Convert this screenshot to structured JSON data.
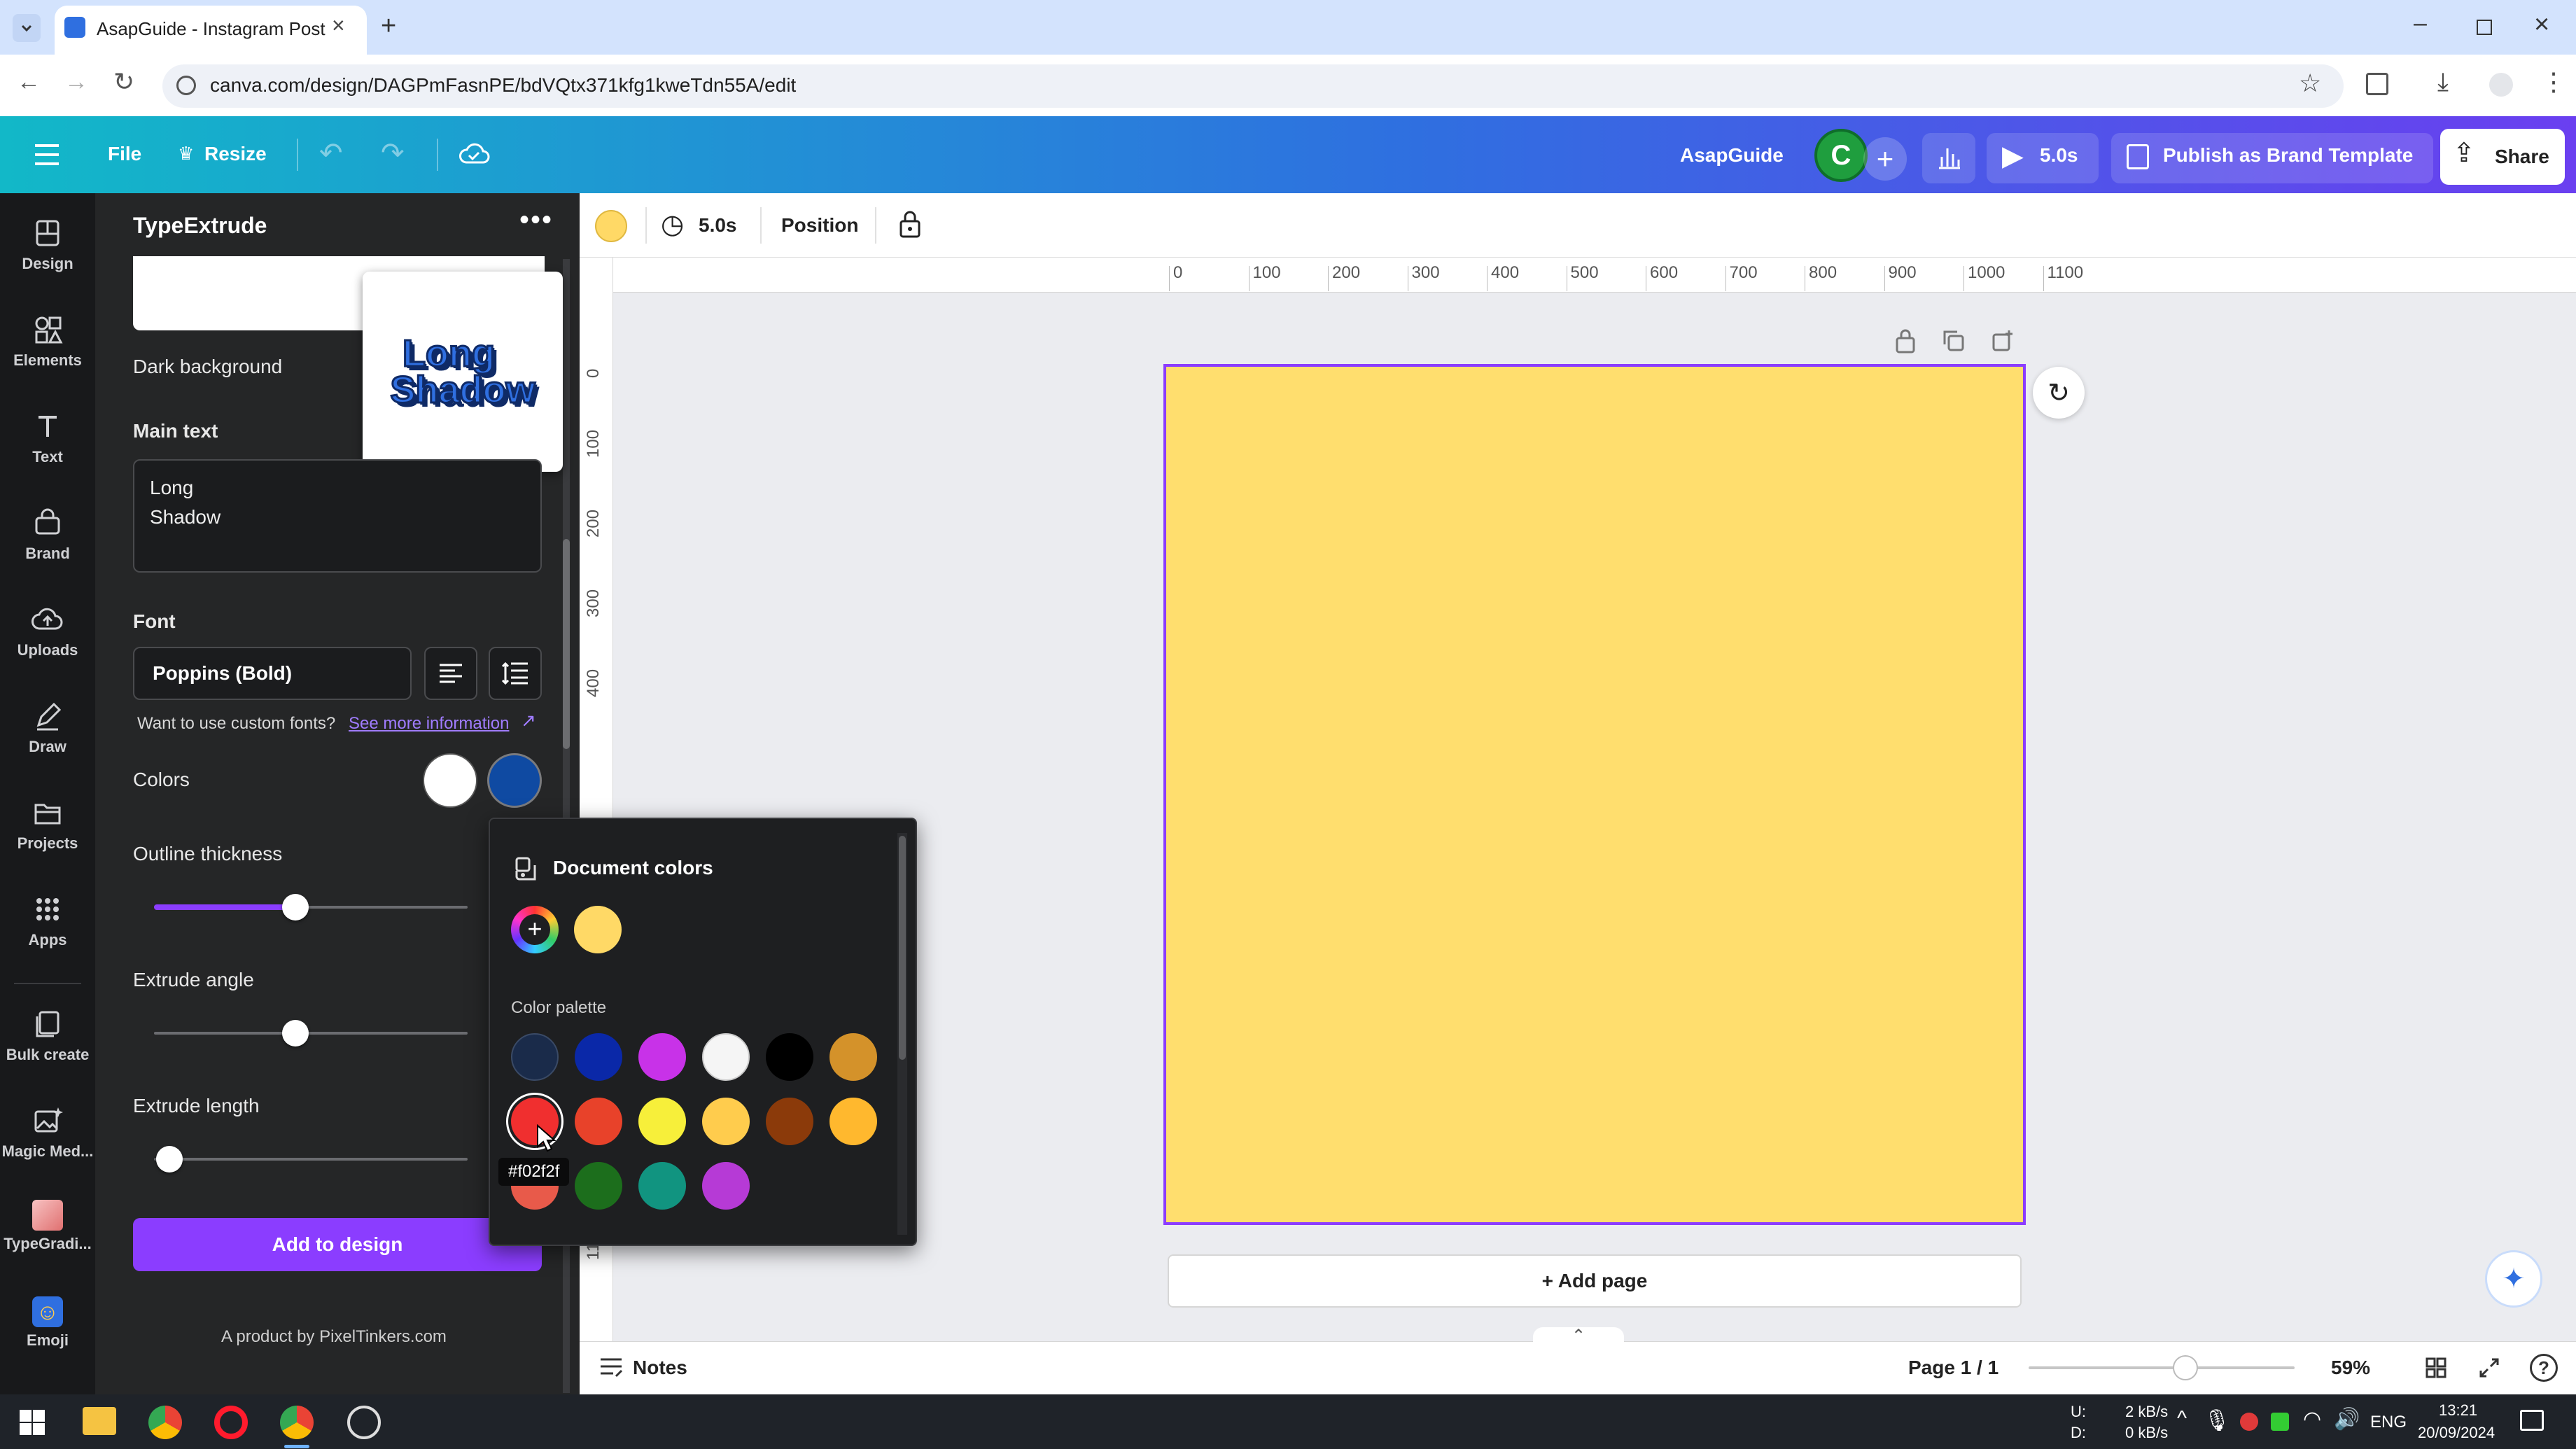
{
  "browser": {
    "tab_title": "AsapGuide - Instagram Post",
    "url": "canva.com/design/DAGPmFasnPE/bdVQtx371kfg1kweTdn55A/edit"
  },
  "header": {
    "file_label": "File",
    "resize_label": "Resize",
    "team_name": "AsapGuide",
    "avatar_initial": "C",
    "play_duration": "5.0s",
    "publish_label": "Publish as Brand Template",
    "share_label": "Share"
  },
  "sidebar": {
    "items": [
      {
        "label": "Design"
      },
      {
        "label": "Elements"
      },
      {
        "label": "Text"
      },
      {
        "label": "Brand"
      },
      {
        "label": "Uploads"
      },
      {
        "label": "Draw"
      },
      {
        "label": "Projects"
      },
      {
        "label": "Apps"
      },
      {
        "label": "Bulk create"
      },
      {
        "label": "Magic Med..."
      },
      {
        "label": "TypeGradi..."
      },
      {
        "label": "Emoji"
      }
    ]
  },
  "panel": {
    "title": "TypeExtrude",
    "dark_background_label": "Dark background",
    "preview_text_line1": "Long",
    "preview_text_line2": "Shadow",
    "main_text_label": "Main text",
    "main_text_line1": "Long",
    "main_text_line2": "Shadow",
    "font_label": "Font",
    "font_value": "Poppins (Bold)",
    "custom_font_text": "Want to use custom fonts?",
    "custom_font_link": "See more information",
    "colors_label": "Colors",
    "outline_label": "Outline thickness",
    "outline_value": 0.45,
    "extrude_angle_label": "Extrude angle",
    "extrude_angle_value": 0.45,
    "extrude_length_label": "Extrude length",
    "extrude_length_value": 0.05,
    "add_button": "Add to design",
    "product_credit": "A product by PixelTinkers.com",
    "color1": "#ffffff",
    "color2": "#0f4aa2"
  },
  "context_bar": {
    "duration": "5.0s",
    "position_label": "Position",
    "bg_color": "#ffd966"
  },
  "ruler": {
    "h_ticks": [
      "0",
      "100",
      "200",
      "300",
      "400",
      "500",
      "600",
      "700",
      "800",
      "900",
      "1000",
      "1100"
    ],
    "v_ticks": [
      "0",
      "100",
      "200",
      "300",
      "400",
      "110"
    ]
  },
  "canvas": {
    "page_color": "#ffde6e",
    "add_page_label": "+ Add page"
  },
  "popup": {
    "doc_colors_title": "Document colors",
    "doc_colors": [
      "#ffd966"
    ],
    "palette_title": "Color palette",
    "palette": [
      [
        "#1a2b4a",
        "#0a28a8",
        "#c832e8",
        "#f5f5f5",
        "#000000",
        "#d4922a"
      ],
      [
        "#f02f2f",
        "#e8422a",
        "#f7ef3a",
        "#ffcc4d",
        "#8b3a0a",
        "#ffb82e"
      ],
      [
        "#e85a4a",
        "#1c6e1c",
        "#119480",
        "#b63ad6"
      ]
    ],
    "tooltip": "#f02f2f"
  },
  "footer": {
    "notes_label": "Notes",
    "page_indicator": "Page 1 / 1",
    "zoom": "59%",
    "zoom_level": 0.59
  },
  "taskbar": {
    "net_up_label": "U:",
    "net_down_label": "D:",
    "net_up": "2 kB/s",
    "net_down": "0 kB/s",
    "lang": "ENG",
    "time": "13:21",
    "date": "20/09/2024"
  }
}
